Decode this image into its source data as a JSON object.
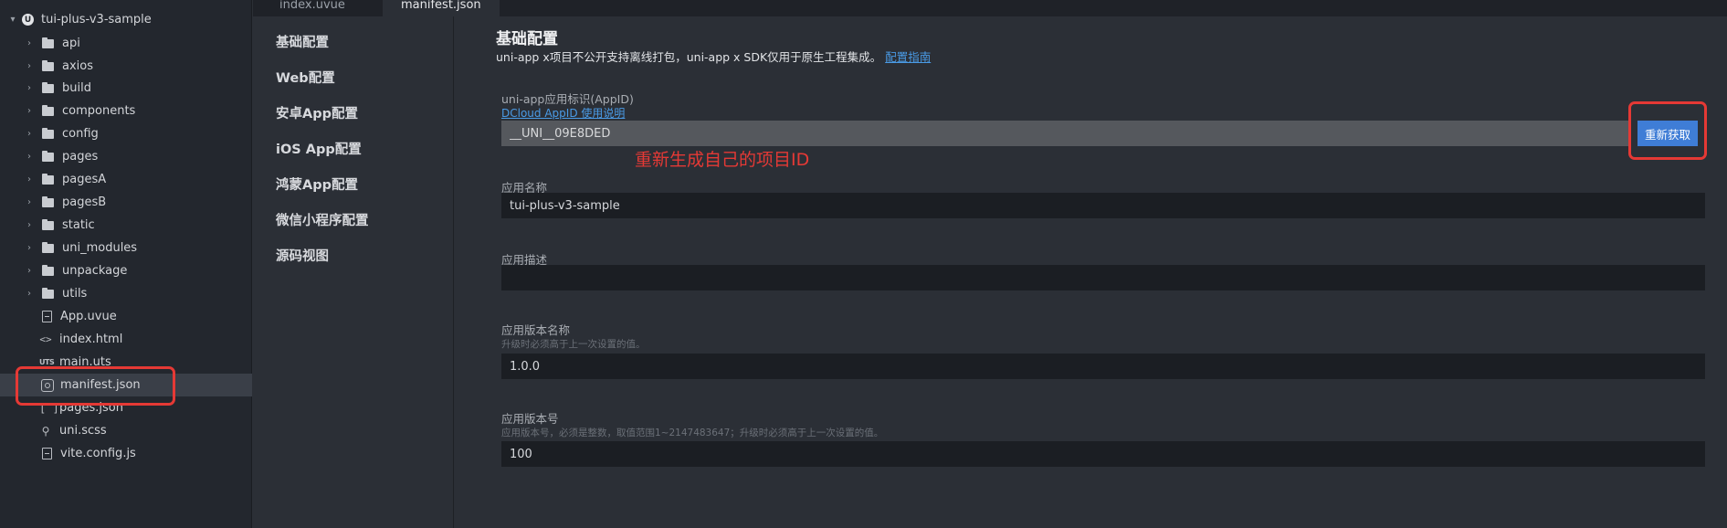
{
  "tree": {
    "root": "tui-plus-v3-sample",
    "folders": [
      "api",
      "axios",
      "build",
      "components",
      "config",
      "pages",
      "pagesA",
      "pagesB",
      "static",
      "uni_modules",
      "unpackage",
      "utils"
    ],
    "files": {
      "app": "App.uvue",
      "index": "index.html",
      "main": "main.uts",
      "manifest": "manifest.json",
      "pages": "pages.json",
      "uniscss": "uni.scss",
      "vite": "vite.config.js"
    },
    "uts_badge": "UTS",
    "root_badge": "U"
  },
  "tabs": {
    "index": "index.uvue",
    "manifest": "manifest.json"
  },
  "nav": {
    "basic": "基础配置",
    "web": "Web配置",
    "android": "安卓App配置",
    "ios": "iOS App配置",
    "harmony": "鸿蒙App配置",
    "wechat": "微信小程序配置",
    "source": "源码视图"
  },
  "form": {
    "title": "基础配置",
    "desc": "uni-app x项目不公开支持离线打包，uni-app x SDK仅用于原生工程集成。",
    "desc_link": "配置指南",
    "appid_label": "uni-app应用标识(AppID)",
    "appid_link": "DCloud AppID 使用说明",
    "appid_value": "__UNI__09E8DED",
    "appid_button": "重新获取",
    "annotation": "重新生成自己的项目ID",
    "name_label": "应用名称",
    "name_value": "tui-plus-v3-sample",
    "desc_label": "应用描述",
    "desc_value": "",
    "vname_label": "应用版本名称",
    "vname_hint": "升级时必须高于上一次设置的值。",
    "vname_value": "1.0.0",
    "vcode_label": "应用版本号",
    "vcode_hint": "应用版本号，必须是整数，取值范围1~2147483647；升级时必须高于上一次设置的值。",
    "vcode_value": "100"
  },
  "colors": {
    "accent": "#3f7dd6",
    "link": "#4a9be6",
    "annotation": "#e53935"
  }
}
